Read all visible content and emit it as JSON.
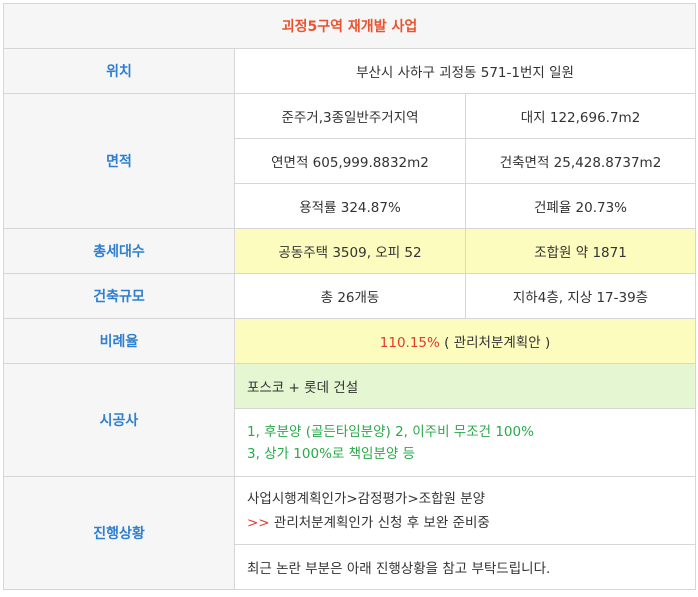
{
  "title": "괴정5구역 재개발 사업",
  "rows": {
    "location": {
      "label": "위치",
      "value": "부산시 사하구 괴정동 571-1번지 일원"
    },
    "area": {
      "label": "면적",
      "r1c1": "준주거,3종일반주거지역",
      "r1c2": "대지 122,696.7m2",
      "r2c1": "연면적 605,999.8832m2",
      "r2c2": "건축면적 25,428.8737m2",
      "r3c1": "용적률 324.87%",
      "r3c2": "건폐율 20.73%"
    },
    "households": {
      "label": "총세대수",
      "c1": "공동주택 3509, 오피 52",
      "c2": "조합원 약 1871"
    },
    "scale": {
      "label": "건축규모",
      "c1": "총 26개동",
      "c2": "지하4층, 지상 17-39층"
    },
    "ratio": {
      "label": "비례율",
      "value_highlight": "110.15%",
      "value_rest": " ( 관리처분계획안 )"
    },
    "builder": {
      "label": "시공사",
      "name": "포스코 + 롯데 건설",
      "note_line1": "1, 후분양 (골든타임분양) 2, 이주비 무조건 100%",
      "note_line2": "3, 상가 100%로 책임분양 등"
    },
    "progress": {
      "label": "진행상황",
      "line1": "사업시행계획인가>감정평가>조합원 분양",
      "line2_marker": ">>",
      "line2_text": " 관리처분계획인가 신청 후 보완 준비중",
      "note": "최근 논란 부분은 아래 진행상황을 참고 부탁드립니다."
    }
  }
}
